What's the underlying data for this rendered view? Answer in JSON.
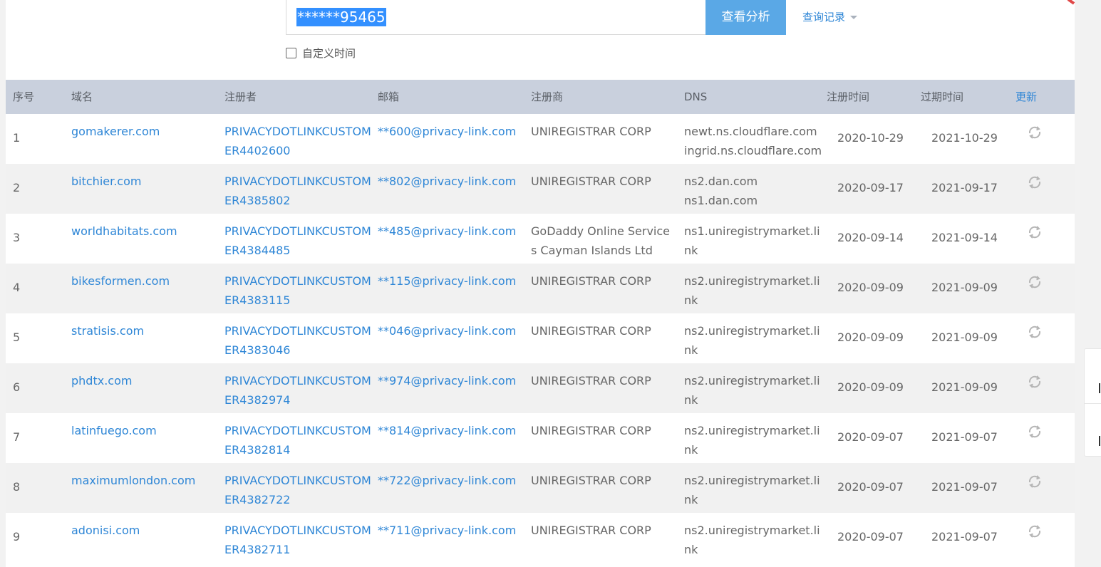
{
  "search": {
    "value": "******95465",
    "button_label": "查看分析",
    "history_label": "查询记录",
    "custom_time_label": "自定义时间"
  },
  "table": {
    "headers": {
      "index": "序号",
      "domain": "域名",
      "registrant": "注册者",
      "email": "邮箱",
      "registrar": "注册商",
      "dns": "DNS",
      "created": "注册时间",
      "expires": "过期时间",
      "update": "更新"
    },
    "rows": [
      {
        "index": "1",
        "domain": "gomakerer.com",
        "registrant": "PRIVACYDOTLINKCUSTOMER4402600",
        "email": "**600@privacy-link.com",
        "registrar": "UNIREGISTRAR CORP",
        "dns": [
          "newt.ns.cloudflare.com",
          "ingrid.ns.cloudflare.com"
        ],
        "created": "2020-10-29",
        "expires": "2021-10-29"
      },
      {
        "index": "2",
        "domain": "bitchier.com",
        "registrant": "PRIVACYDOTLINKCUSTOMER4385802",
        "email": "**802@privacy-link.com",
        "registrar": "UNIREGISTRAR CORP",
        "dns": [
          "ns2.dan.com",
          "ns1.dan.com"
        ],
        "created": "2020-09-17",
        "expires": "2021-09-17"
      },
      {
        "index": "3",
        "domain": "worldhabitats.com",
        "registrant": "PRIVACYDOTLINKCUSTOMER4384485",
        "email": "**485@privacy-link.com",
        "registrar": "GoDaddy Online Services Cayman Islands Ltd",
        "dns": [
          "ns1.uniregistrymarket.link"
        ],
        "created": "2020-09-14",
        "expires": "2021-09-14"
      },
      {
        "index": "4",
        "domain": "bikesformen.com",
        "registrant": "PRIVACYDOTLINKCUSTOMER4383115",
        "email": "**115@privacy-link.com",
        "registrar": "UNIREGISTRAR CORP",
        "dns": [
          "ns2.uniregistrymarket.link"
        ],
        "created": "2020-09-09",
        "expires": "2021-09-09"
      },
      {
        "index": "5",
        "domain": "stratisis.com",
        "registrant": "PRIVACYDOTLINKCUSTOMER4383046",
        "email": "**046@privacy-link.com",
        "registrar": "UNIREGISTRAR CORP",
        "dns": [
          "ns2.uniregistrymarket.link"
        ],
        "created": "2020-09-09",
        "expires": "2021-09-09"
      },
      {
        "index": "6",
        "domain": "phdtx.com",
        "registrant": "PRIVACYDOTLINKCUSTOMER4382974",
        "email": "**974@privacy-link.com",
        "registrar": "UNIREGISTRAR CORP",
        "dns": [
          "ns2.uniregistrymarket.link"
        ],
        "created": "2020-09-09",
        "expires": "2021-09-09"
      },
      {
        "index": "7",
        "domain": "latinfuego.com",
        "registrant": "PRIVACYDOTLINKCUSTOMER4382814",
        "email": "**814@privacy-link.com",
        "registrar": "UNIREGISTRAR CORP",
        "dns": [
          "ns2.uniregistrymarket.link"
        ],
        "created": "2020-09-07",
        "expires": "2021-09-07"
      },
      {
        "index": "8",
        "domain": "maximumlondon.com",
        "registrant": "PRIVACYDOTLINKCUSTOMER4382722",
        "email": "**722@privacy-link.com",
        "registrar": "UNIREGISTRAR CORP",
        "dns": [
          "ns2.uniregistrymarket.link"
        ],
        "created": "2020-09-07",
        "expires": "2021-09-07"
      },
      {
        "index": "9",
        "domain": "adonisi.com",
        "registrant": "PRIVACYDOTLINKCUSTOMER4382711",
        "email": "**711@privacy-link.com",
        "registrar": "UNIREGISTRAR CORP",
        "dns": [
          "ns2.uniregistrymarket.link"
        ],
        "created": "2020-09-07",
        "expires": "2021-09-07"
      }
    ]
  },
  "colors": {
    "accent": "#2e86d6",
    "button": "#5aa8e6",
    "header_bg": "#c9d0dd",
    "selection": "#3390ff"
  },
  "icons": {
    "refresh": "refresh-icon",
    "caret": "caret-down-icon"
  }
}
